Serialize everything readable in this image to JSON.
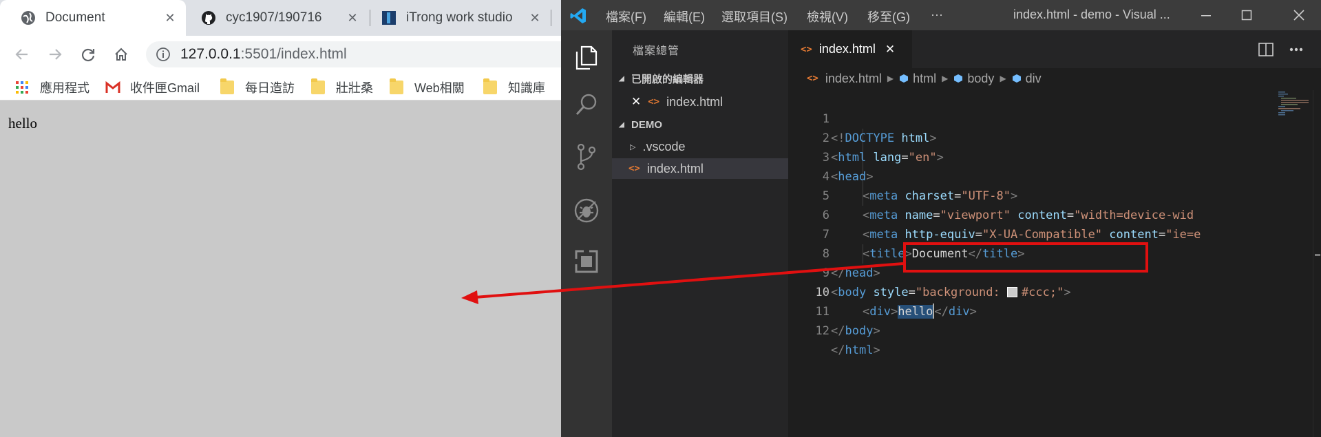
{
  "browser": {
    "tabs": [
      {
        "title": "Document",
        "icon": "globe-icon",
        "active": true
      },
      {
        "title": "cyc1907/190716",
        "icon": "github-icon",
        "active": false
      },
      {
        "title": "iTrong work studio",
        "icon": "itrong-icon",
        "active": false
      }
    ],
    "address": {
      "host": "127.0.0.1",
      "rest": ":5501/index.html"
    },
    "bookmarks": [
      {
        "label": "應用程式",
        "icon": "apps-grid-icon"
      },
      {
        "label": "收件匣Gmail",
        "icon": "gmail-icon"
      },
      {
        "label": "每日造訪",
        "icon": "folder-icon"
      },
      {
        "label": "壯壯桑",
        "icon": "folder-icon"
      },
      {
        "label": "Web相關",
        "icon": "folder-icon"
      },
      {
        "label": "知識庫",
        "icon": "folder-icon"
      }
    ],
    "page_text": "hello",
    "page_background": "#cccccc"
  },
  "vscode": {
    "menu": [
      "檔案(F)",
      "編輯(E)",
      "選取項目(S)",
      "檢視(V)",
      "移至(G)",
      "···"
    ],
    "window_title": "index.html - demo - Visual ...",
    "sidebar": {
      "header": "檔案總管",
      "open_editors_label": "已開啟的編輯器",
      "open_editor_file": "index.html",
      "workspace_label": "DEMO",
      "folder": ".vscode",
      "file": "index.html"
    },
    "editor_tab": "index.html",
    "breadcrumb": [
      "index.html",
      "html",
      "body",
      "div"
    ],
    "line_numbers": [
      "1",
      "2",
      "3",
      "4",
      "5",
      "6",
      "7",
      "8",
      "9",
      "10",
      "11",
      "12"
    ],
    "code": {
      "l1": {
        "p1": "<!",
        "tag": "DOCTYPE",
        "attr": " html",
        "p2": ">"
      },
      "l2": {
        "p1": "<",
        "tag": "html",
        "attr": " lang",
        "eq": "=",
        "str": "\"en\"",
        "p2": ">"
      },
      "l3": {
        "p1": "<",
        "tag": "head",
        "p2": ">"
      },
      "l4": {
        "p1": "<",
        "tag": "meta",
        "attr": " charset",
        "eq": "=",
        "str": "\"UTF-8\"",
        "p2": ">"
      },
      "l5": {
        "p1": "<",
        "tag": "meta",
        "attr1": " name",
        "eq1": "=",
        "str1": "\"viewport\"",
        "attr2": " content",
        "eq2": "=",
        "str2": "\"width=device-wid"
      },
      "l6": {
        "p1": "<",
        "tag": "meta",
        "attr1": " http-equiv",
        "eq1": "=",
        "str1": "\"X-UA-Compatible\"",
        "attr2": " content",
        "eq2": "=",
        "str2": "\"ie=e"
      },
      "l7": {
        "p1": "<",
        "tag": "title",
        "p2": ">",
        "txt": "Document",
        "p3": "</",
        "tag2": "title",
        "p4": ">"
      },
      "l8": {
        "p1": "</",
        "tag": "head",
        "p2": ">"
      },
      "l9": {
        "p1": "<",
        "tag": "body",
        "attr": " style",
        "eq": "=",
        "str1": "\"background: ",
        "str2": "#ccc;\"",
        "p2": ">"
      },
      "l10": {
        "p1": "<",
        "tag": "div",
        "p2": ">",
        "txt": "hello",
        "p3": "</",
        "tag2": "div",
        "p4": ">"
      },
      "l11": {
        "p1": "</",
        "tag": "body",
        "p2": ">"
      },
      "l12": {
        "p1": "</",
        "tag": "html",
        "p2": ">"
      }
    },
    "current_line": "10"
  },
  "colors": {
    "annotation": "#e01010",
    "swatch": "#cccccc",
    "vscode_accent": "#007acc"
  }
}
